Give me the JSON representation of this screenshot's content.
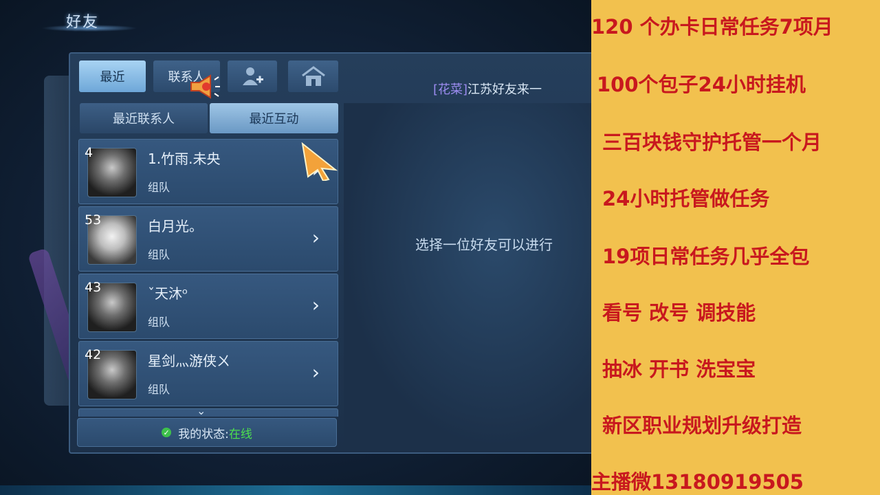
{
  "window": {
    "title": "好友"
  },
  "tabs": {
    "recent": "最近",
    "contacts": "联系人"
  },
  "marquee": {
    "tag": "[花菜]",
    "text": "江苏好友来一"
  },
  "subtabs": {
    "recent_contacts": "最近联系人",
    "recent_interactions": "最近互动"
  },
  "friends": [
    {
      "level": "4",
      "name": "1.竹雨.未央",
      "status": "组队"
    },
    {
      "level": "53",
      "name": "白月光。",
      "status": "组队"
    },
    {
      "level": "43",
      "name": "ˇ天沐ᵒ",
      "status": "组队"
    },
    {
      "level": "42",
      "name": "星剑灬游侠ㄨ",
      "status": "组队"
    }
  ],
  "my_status": {
    "label": "我的状态:",
    "value": "在线"
  },
  "hint": "选择一位好友可以进行",
  "ad": {
    "lines": [
      "120 个办卡日常任务7项月",
      "100个包子24小时挂机",
      "三百块钱守护托管一个月",
      "24小时托管做任务",
      "19项日常任务几乎全包",
      "看号  改号  调技能",
      "抽冰 开书 洗宝宝",
      "新区职业规划升级打造",
      "主播微13180919505"
    ]
  },
  "colors": {
    "ad_bg": "#f2c14e",
    "ad_text": "#c8181e",
    "online": "#4de04e"
  }
}
